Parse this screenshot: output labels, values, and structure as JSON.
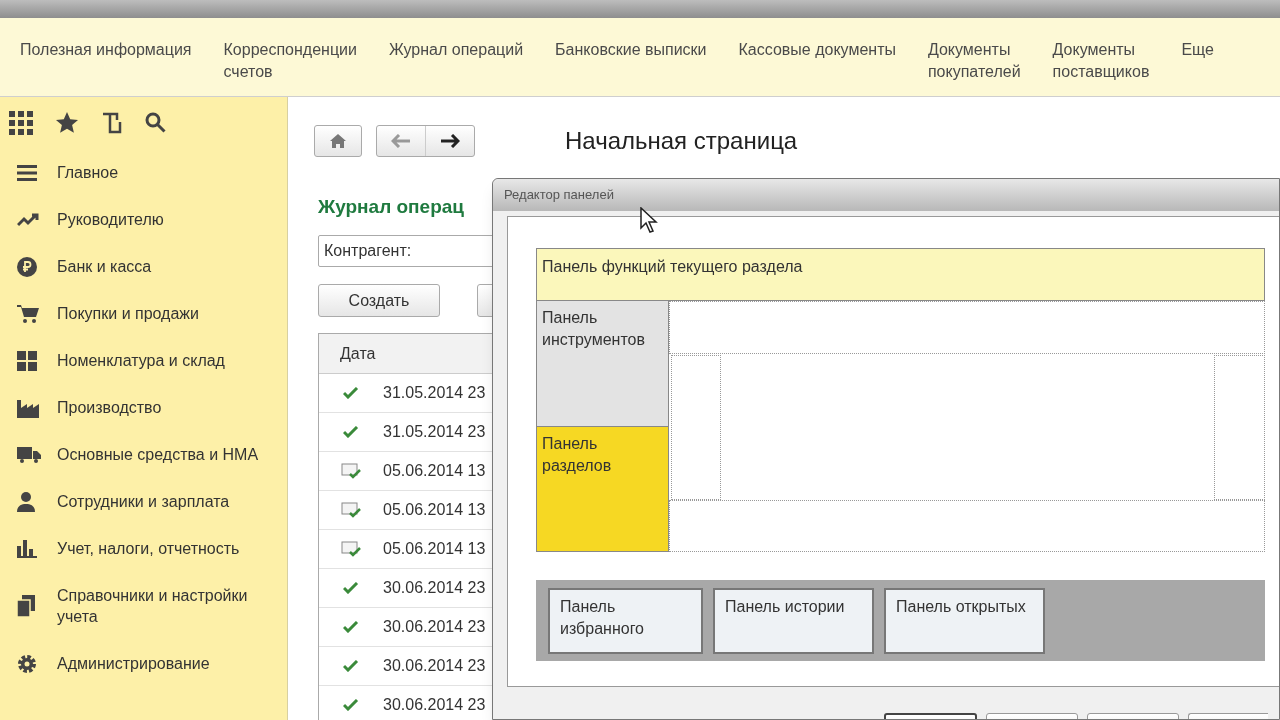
{
  "top_menu": [
    {
      "label": "Полезная информация"
    },
    {
      "label": "Корреспонденции\nсчетов"
    },
    {
      "label": "Журнал операций"
    },
    {
      "label": "Банковские выписки"
    },
    {
      "label": "Кассовые документы"
    },
    {
      "label": "Документы\nпокупателей"
    },
    {
      "label": "Документы\nпоставщиков"
    },
    {
      "label": "Еще"
    }
  ],
  "sidebar": {
    "items": [
      {
        "label": "Главное",
        "kind": "menu"
      },
      {
        "label": "Руководителю",
        "kind": "trend"
      },
      {
        "label": "Банк и касса",
        "kind": "coin"
      },
      {
        "label": "Покупки и продажи",
        "kind": "cart"
      },
      {
        "label": "Номенклатура и склад",
        "kind": "blocks"
      },
      {
        "label": "Производство",
        "kind": "factory"
      },
      {
        "label": "Основные средства и НМА",
        "kind": "truck"
      },
      {
        "label": "Сотрудники и зарплата",
        "kind": "person"
      },
      {
        "label": "Учет, налоги, отчетность",
        "kind": "bars"
      },
      {
        "label": "Справочники и настройки учета",
        "kind": "docs"
      },
      {
        "label": "Администрирование",
        "kind": "gear"
      }
    ]
  },
  "page_title": "Начальная страница",
  "journal": {
    "title": "Журнал операц",
    "filter_label": "Контрагент:",
    "create_button": "Создать",
    "columns": [
      "Дата"
    ],
    "rows": [
      {
        "kind": "posted",
        "date": "31.05.2014 23"
      },
      {
        "kind": "posted",
        "date": "31.05.2014 23"
      },
      {
        "kind": "document",
        "date": "05.06.2014 13"
      },
      {
        "kind": "document",
        "date": "05.06.2014 13"
      },
      {
        "kind": "document",
        "date": "05.06.2014 13"
      },
      {
        "kind": "posted",
        "date": "30.06.2014 23"
      },
      {
        "kind": "posted",
        "date": "30.06.2014 23"
      },
      {
        "kind": "posted",
        "date": "30.06.2014 23"
      },
      {
        "kind": "posted",
        "date": "30.06.2014 23"
      }
    ]
  },
  "dialog": {
    "title": "Редактор панелей",
    "functions_panel": "Панель функций текущего раздела",
    "tools_panel": "Панель инструментов",
    "sections_panel": "Панель разделов",
    "bottom_panels": [
      "Панель избранного",
      "Панель истории",
      "Панель открытых"
    ]
  }
}
